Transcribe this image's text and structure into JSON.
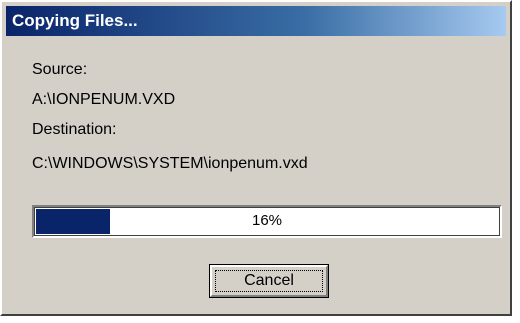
{
  "window": {
    "title": "Copying Files..."
  },
  "source": {
    "label": "Source:",
    "path": "A:\\IONPENUM.VXD"
  },
  "destination": {
    "label": "Destination:",
    "path": "C:\\WINDOWS\\SYSTEM\\ionpenum.vxd"
  },
  "progress": {
    "percent": 16,
    "text": "16%"
  },
  "buttons": {
    "cancel_label": "Cancel"
  },
  "colors": {
    "title_bar_start": "#0a246a",
    "title_bar_end": "#a6caf0",
    "progress_fill": "#0a246a",
    "dialog_face": "#d4d0c8"
  }
}
